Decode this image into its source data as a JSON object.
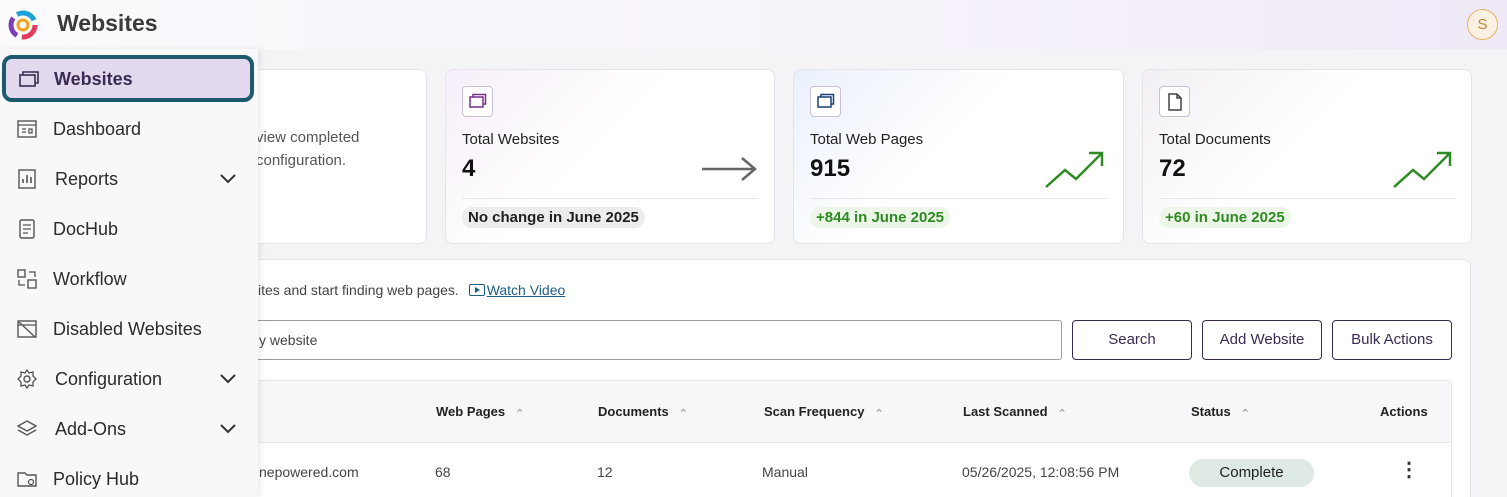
{
  "header": {
    "title": "Websites",
    "avatar_initial": "S"
  },
  "sidebar": {
    "items": [
      {
        "label": "Websites",
        "icon": "websites-icon",
        "active": true
      },
      {
        "label": "Dashboard",
        "icon": "dashboard-icon"
      },
      {
        "label": "Reports",
        "icon": "reports-icon",
        "expandable": true
      },
      {
        "label": "DocHub",
        "icon": "dochub-icon"
      },
      {
        "label": "Workflow",
        "icon": "workflow-icon"
      },
      {
        "label": "Disabled Websites",
        "icon": "disabled-websites-icon"
      },
      {
        "label": "Configuration",
        "icon": "gear-icon",
        "expandable": true
      },
      {
        "label": "Add-Ons",
        "icon": "layers-icon",
        "expandable": true
      },
      {
        "label": "Policy Hub",
        "icon": "policy-folder-icon"
      }
    ]
  },
  "cards": {
    "partial_text_line1": "view completed",
    "partial_text_line2": "configuration.",
    "websites": {
      "label": "Total Websites",
      "value": "4",
      "note": "No change in June 2025"
    },
    "pages": {
      "label": "Total Web Pages",
      "value": "915",
      "note": "+844 in June 2025"
    },
    "documents": {
      "label": "Total Documents",
      "value": "72",
      "note": "+60 in June 2025"
    }
  },
  "panel": {
    "intro": "ites and start finding web pages.",
    "watch_video": "Watch Video",
    "search_placeholder": "y website",
    "search_button": "Search",
    "add_button": "Add Website",
    "bulk_button": "Bulk Actions"
  },
  "table": {
    "headers": [
      "Web Pages",
      "Documents",
      "Scan Frequency",
      "Last Scanned",
      "Status",
      "Actions"
    ],
    "rows": [
      {
        "website": "nepowered.com",
        "web_pages": "68",
        "documents": "12",
        "scan_frequency": "Manual",
        "last_scanned": "05/26/2025, 12:08:56 PM",
        "status": "Complete"
      }
    ]
  },
  "colors": {
    "accent": "#3a2b52",
    "active_border": "#1d5a6e",
    "success": "#2e8b22"
  }
}
